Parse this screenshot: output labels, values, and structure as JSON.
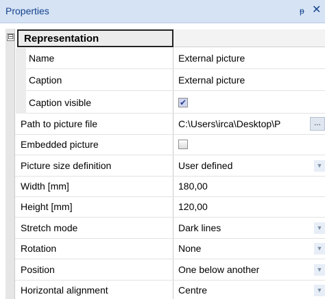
{
  "panel": {
    "title": "Properties",
    "pin_icon": "pin-icon",
    "close_icon": "close-icon"
  },
  "category": {
    "label": "Representation",
    "expander": "⊟"
  },
  "rows": [
    {
      "name": "Name",
      "value": "External picture"
    },
    {
      "name": "Caption",
      "value": "External picture"
    },
    {
      "name": "Caption visible",
      "value": true
    },
    {
      "name": "Path to picture file",
      "value": "C:\\Users\\irca\\Desktop\\P",
      "button": "..."
    },
    {
      "name": "Embedded picture",
      "value": false
    },
    {
      "name": "Picture size definition",
      "value": "User defined"
    },
    {
      "name": "Width [mm]",
      "value": "180,00"
    },
    {
      "name": "Height [mm]",
      "value": "120,00"
    },
    {
      "name": "Stretch mode",
      "value": "Dark lines"
    },
    {
      "name": "Rotation",
      "value": "None"
    },
    {
      "name": "Position",
      "value": "One below another"
    },
    {
      "name": "Horizontal alignment",
      "value": "Centre"
    }
  ],
  "colors": {
    "title_bar": "#d5e3f5",
    "title_text": "#15428b",
    "gutter": "#e6e6e6",
    "grid_line": "#c9c9c9"
  }
}
